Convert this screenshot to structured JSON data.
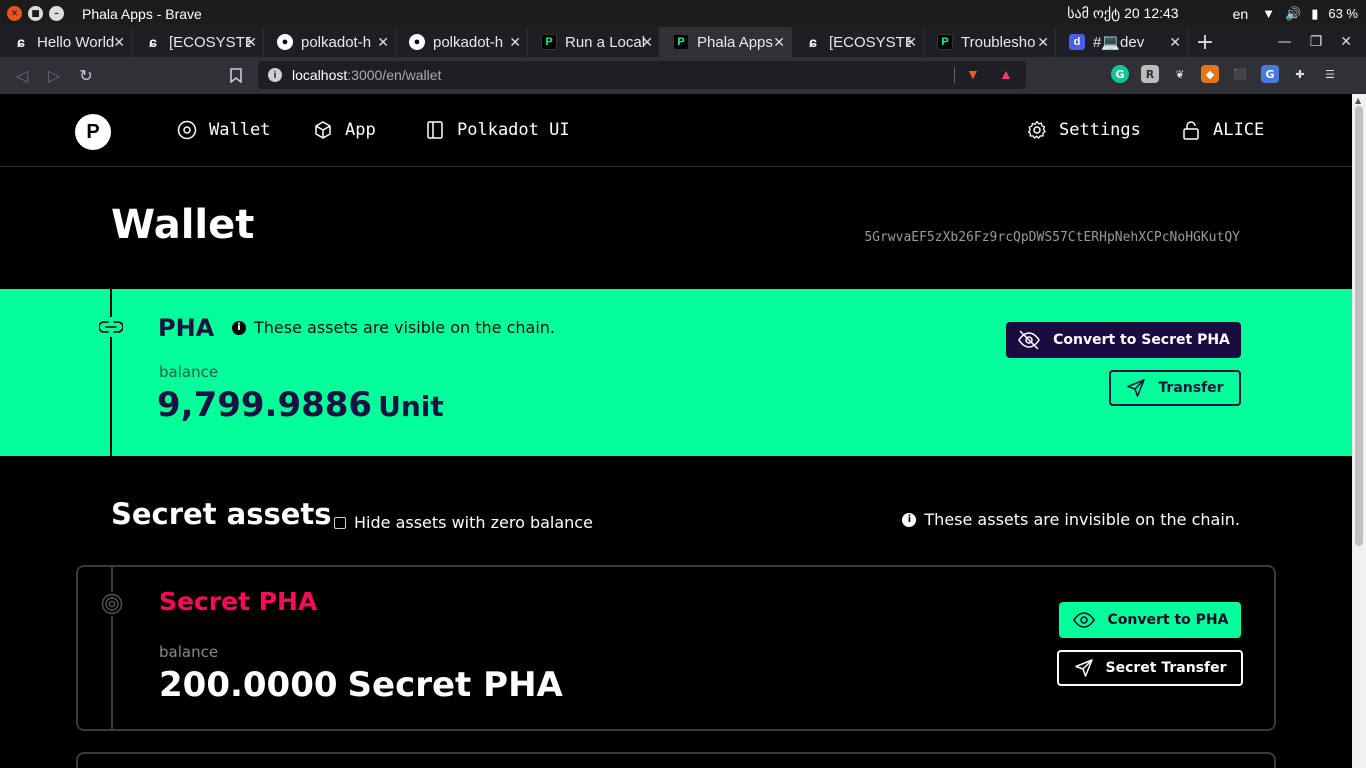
{
  "os": {
    "window_title": "Phala Apps - Brave",
    "clock": "სამ ოქტ 20  12:43",
    "lang": "en",
    "battery": "63 %"
  },
  "tabs": [
    {
      "label": "Hello World",
      "icon": "ecosystem-icon",
      "active": false
    },
    {
      "label": "[ECOSYSTEM",
      "icon": "ecosystem-icon",
      "active": false
    },
    {
      "label": "polkadot-h",
      "icon": "github-icon",
      "active": false
    },
    {
      "label": "polkadot-h",
      "icon": "github-icon",
      "active": false
    },
    {
      "label": "Run a Local",
      "icon": "phala-icon",
      "active": false
    },
    {
      "label": "Phala Apps",
      "icon": "phala-icon",
      "active": true
    },
    {
      "label": "[ECOSYSTE",
      "icon": "ecosystem-icon",
      "active": false
    },
    {
      "label": "Troublesho",
      "icon": "phala-icon",
      "active": false
    },
    {
      "label": "#💻dev",
      "icon": "discord-icon",
      "active": false
    }
  ],
  "address_bar": {
    "host": "localhost",
    "path": ":3000/en/wallet"
  },
  "nav": {
    "wallet": "Wallet",
    "app": "App",
    "polkadot_ui": "Polkadot UI",
    "settings": "Settings",
    "account": "ALICE"
  },
  "wallet": {
    "title": "Wallet",
    "address": "5GrwvaEF5zXb26Fz9rcQpDWS57CtERHpNehXCPcNoHGKutQY"
  },
  "pha": {
    "name": "PHA",
    "info": "These assets are visible on the chain.",
    "balance_label": "balance",
    "balance": "9,799.9886",
    "unit": "Unit",
    "convert_label": "Convert to Secret PHA",
    "transfer_label": "Transfer"
  },
  "secret": {
    "title": "Secret assets",
    "hide_zero_label": "Hide assets with zero balance",
    "info": "These assets are invisible on the chain.",
    "card": {
      "name": "Secret PHA",
      "balance_label": "balance",
      "balance": "200.0000",
      "unit": "Secret PHA",
      "convert_label": "Convert to PHA",
      "transfer_label": "Secret Transfer"
    }
  }
}
